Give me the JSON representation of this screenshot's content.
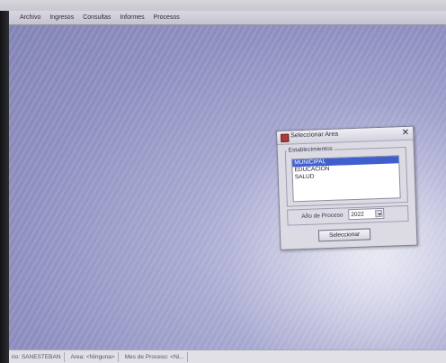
{
  "app": {
    "title": ""
  },
  "menubar": {
    "items": [
      "Archivo",
      "Ingresos",
      "Consultas",
      "Informes",
      "Procesos"
    ]
  },
  "dialog": {
    "title": "Seleccionar Area",
    "group_label": "Establecimientos",
    "options": [
      "MUNICIPAL",
      "EDUCACION",
      "SALUD"
    ],
    "selected_index": 0,
    "year_label": "Año de Proceso",
    "year_value": "2022",
    "select_button": "Seleccionar"
  },
  "statusbar": {
    "cells": [
      "rio: SANESTEBAN",
      "Area: <Ninguna>",
      "Mes de Proceso: <Ni..."
    ]
  }
}
